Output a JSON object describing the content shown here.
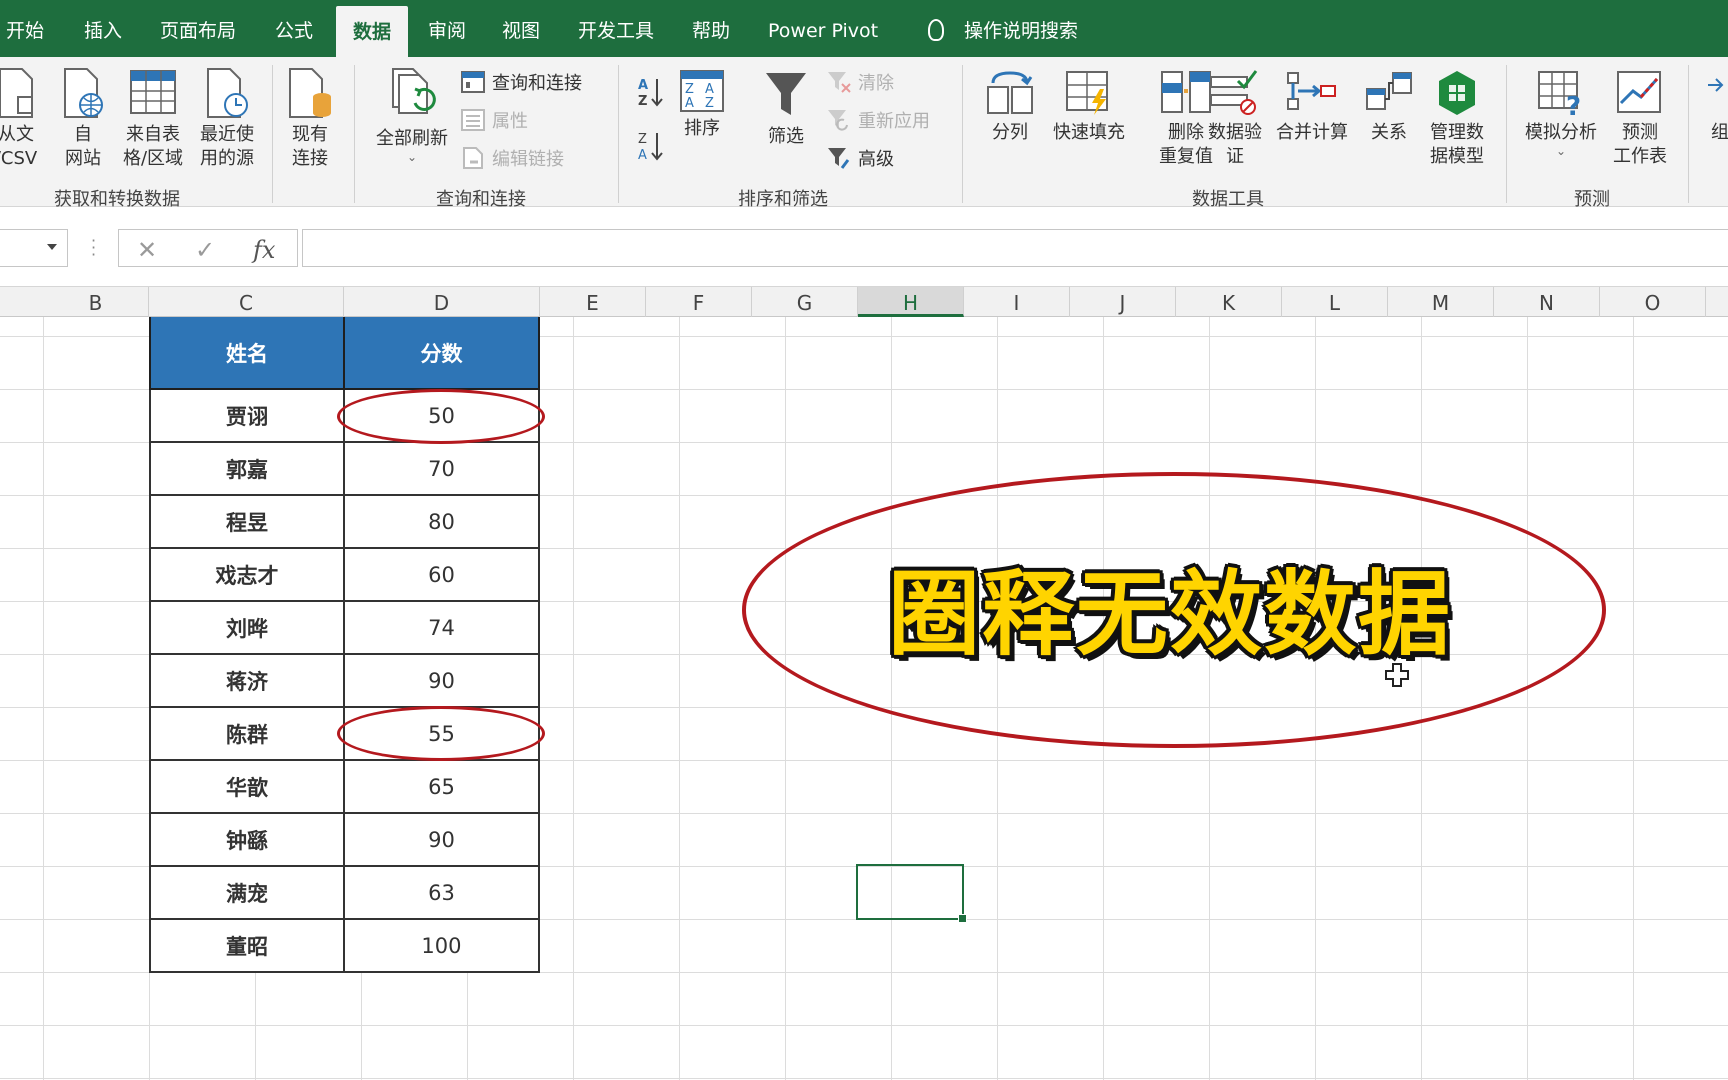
{
  "tabs": [
    {
      "label": "开始",
      "active": false
    },
    {
      "label": "插入",
      "active": false
    },
    {
      "label": "页面布局",
      "active": false
    },
    {
      "label": "公式",
      "active": false
    },
    {
      "label": "数据",
      "active": true
    },
    {
      "label": "审阅",
      "active": false
    },
    {
      "label": "视图",
      "active": false
    },
    {
      "label": "开发工具",
      "active": false
    },
    {
      "label": "帮助",
      "active": false
    },
    {
      "label": "Power Pivot",
      "active": false
    },
    {
      "label": "操作说明搜索",
      "active": false,
      "icon": "lightbulb-icon"
    }
  ],
  "ribbon": {
    "get_transform": {
      "label": "获取和转换数据",
      "from_text": "从文\n/CSV",
      "from_web": "自\n网站",
      "from_table": "来自表\n格/区域",
      "recent_sources": "最近使\n用的源",
      "existing": "现有\n连接"
    },
    "queries": {
      "label": "查询和连接",
      "refresh_all": "全部刷新",
      "queries_connections": "查询和连接",
      "properties": "属性",
      "edit_links": "编辑链接"
    },
    "sort_filter": {
      "label": "排序和筛选",
      "sort": "排序",
      "filter": "筛选",
      "clear": "清除",
      "reapply": "重新应用",
      "advanced": "高级"
    },
    "data_tools": {
      "label": "数据工具",
      "text_to_columns": "分列",
      "flash_fill": "快速填充",
      "remove_duplicates": "删除\n重复值",
      "data_validation": "数据验\n证",
      "consolidate": "合并计算",
      "relationships": "关系",
      "manage_model": "管理数\n据模型"
    },
    "forecast": {
      "label": "预测",
      "what_if": "模拟分析",
      "forecast_sheet": "预测\n工作表"
    },
    "partial_right": "组"
  },
  "formula_bar": {
    "name_box": "",
    "cancel": "✕",
    "enter": "✓",
    "fx": "fx",
    "formula": ""
  },
  "columns": [
    "B",
    "C",
    "D",
    "E",
    "F",
    "G",
    "H",
    "I",
    "J",
    "K",
    "L",
    "M",
    "N",
    "O"
  ],
  "selected_column": "H",
  "table": {
    "headers": [
      "姓名",
      "分数"
    ],
    "rows": [
      [
        "贾诩",
        "50"
      ],
      [
        "郭嘉",
        "70"
      ],
      [
        "程昱",
        "80"
      ],
      [
        "戏志才",
        "60"
      ],
      [
        "刘晔",
        "74"
      ],
      [
        "蒋济",
        "90"
      ],
      [
        "陈群",
        "55"
      ],
      [
        "华歆",
        "65"
      ],
      [
        "钟繇",
        "90"
      ],
      [
        "满宠",
        "63"
      ],
      [
        "董昭",
        "100"
      ]
    ],
    "circled_values": [
      "50",
      "55"
    ]
  },
  "caption": "圈释无效数据",
  "colors": {
    "tab_bar": "#1e6e3e",
    "header_fill": "#2e75b6",
    "circle": "#b4191e",
    "caption": "#ffd400"
  }
}
